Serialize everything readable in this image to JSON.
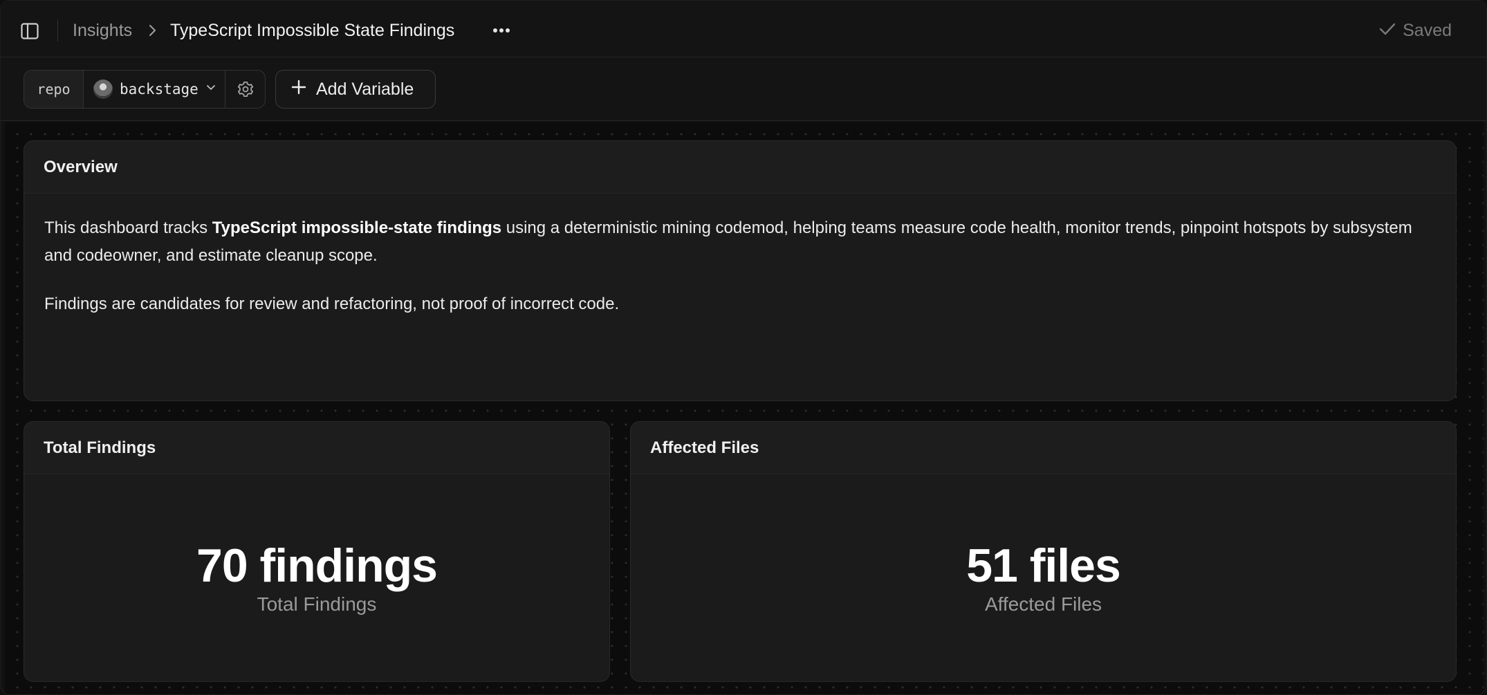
{
  "header": {
    "breadcrumb_root": "Insights",
    "title": "TypeScript Impossible State Findings",
    "status": "Saved"
  },
  "variables": {
    "repo": {
      "label": "repo",
      "value": "backstage"
    },
    "add_label": "Add Variable"
  },
  "overview": {
    "title": "Overview",
    "p1_pre": "This dashboard tracks ",
    "p1_bold": "TypeScript impossible-state findings",
    "p1_post": " using a deterministic mining codemod, helping teams measure code health, monitor trends, pinpoint hotspots by subsystem and codeowner, and estimate cleanup scope.",
    "p2": "Findings are candidates for review and refactoring, not proof of incorrect code."
  },
  "cards": {
    "total": {
      "title": "Total Findings",
      "value": "70 findings",
      "label": "Total Findings"
    },
    "affected": {
      "title": "Affected Files",
      "value": "51 files",
      "label": "Affected Files"
    }
  }
}
